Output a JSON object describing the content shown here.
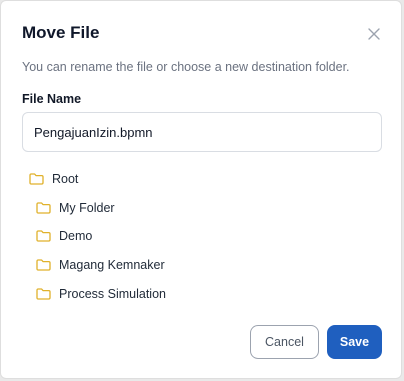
{
  "dialog": {
    "title": "Move File",
    "subtitle": "You can rename the file or choose a new destination folder.",
    "close_icon": "close-icon"
  },
  "file_name": {
    "label": "File Name",
    "value": "PengajuanIzin.bpmn"
  },
  "folders": {
    "root": "Root",
    "items": [
      "My Folder",
      "Demo",
      "Magang Kemnaker",
      "Process Simulation"
    ],
    "icon": "folder-icon",
    "icon_color": "#e0b12a"
  },
  "actions": {
    "cancel_label": "Cancel",
    "save_label": "Save",
    "primary_color": "#1f5fbf"
  }
}
